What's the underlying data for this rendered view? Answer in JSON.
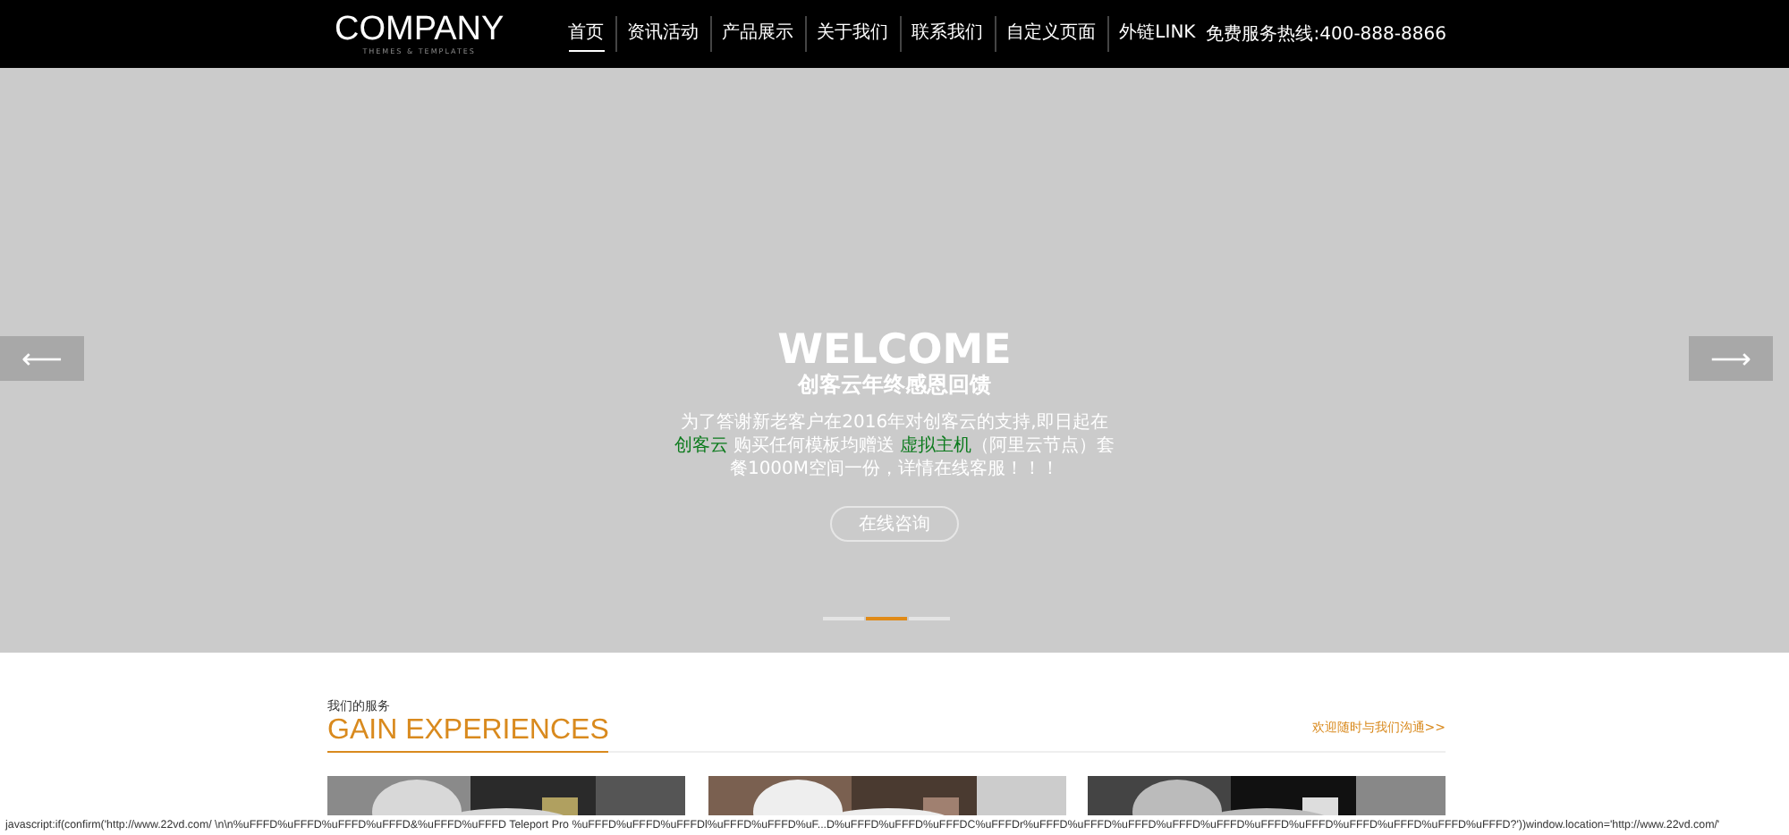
{
  "header": {
    "logo": {
      "name": "COMPANY",
      "tagline": "THEMES & TEMPLATES"
    },
    "nav": [
      {
        "label": "首页",
        "selected": true
      },
      {
        "label": "资讯活动",
        "selected": false
      },
      {
        "label": "产品展示",
        "selected": false
      },
      {
        "label": "关于我们",
        "selected": false
      },
      {
        "label": "联系我们",
        "selected": false
      },
      {
        "label": "自定义页面",
        "selected": false
      },
      {
        "label": "外链LINK",
        "selected": false
      }
    ],
    "hotline": "免费服务热线:400-888-8866"
  },
  "banner": {
    "prev": "⟵",
    "next": "⟶",
    "title": "WELCOME",
    "subtitle": "创客云年终感恩回馈",
    "paragraph": [
      {
        "kind": "text",
        "text": "为了答谢新老客户在2016年对创客云的支持,即日起在 "
      },
      {
        "kind": "link",
        "text": "创客云"
      },
      {
        "kind": "text",
        "text": " 购买任何模板均赠送 "
      },
      {
        "kind": "link",
        "text": "虚拟主机"
      },
      {
        "kind": "text",
        "text": "（阿里云节点）套餐1000M空间一份，详情在线客服！！！"
      }
    ],
    "button": "在线咨询",
    "dots": [
      {
        "selected": false
      },
      {
        "selected": true
      },
      {
        "selected": false
      }
    ]
  },
  "services": {
    "kicker": "我们的服务",
    "title": "GAIN EXPERIENCES",
    "link": "欢迎随时与我们沟通>>"
  },
  "status_bar": "javascript:if(confirm('http://www.22vd.com/ \\n\\n%uFFFD%uFFFD%uFFFD%uFFFD&%uFFFD%uFFFD Teleport Pro %uFFFD%uFFFD%uFFFDl%uFFFD%uFFFD%uF...D%uFFFD%uFFFD%uFFFDC%uFFFDr%uFFFD%uFFFD%uFFFD%uFFFD%uFFFD%uFFFD%uFFFD%uFFFD%uFFFD%uFFFD%uFFFD?'))window.location='http://www.22vd.com/'"
}
